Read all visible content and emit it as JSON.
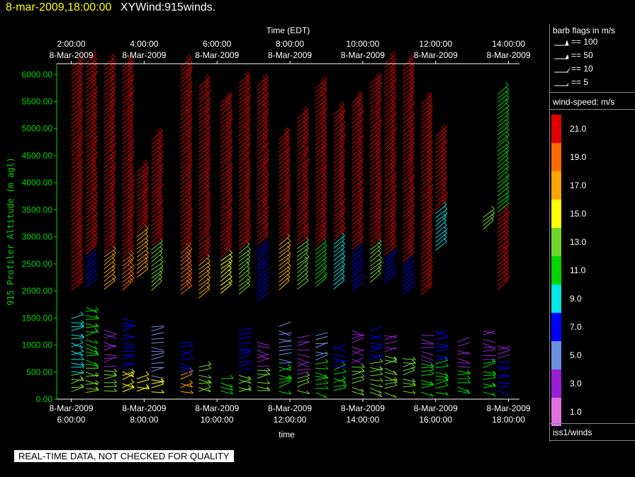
{
  "header": {
    "datetime": "8-mar-2009,18:00:00",
    "product": "XYWind:915winds."
  },
  "disclaimer": "REAL-TIME DATA, NOT CHECKED FOR QUALITY",
  "legend": {
    "barb_title": "barb flags in m/s",
    "barb_flags": [
      "== 100",
      "== 50",
      "== 10",
      "== 5"
    ],
    "speed_title": "wind-speed: m/s",
    "colorbar": [
      {
        "label": "21.0",
        "color": "#e00000"
      },
      {
        "label": "19.0",
        "color": "#ff6a00"
      },
      {
        "label": "17.0",
        "color": "#ffa500"
      },
      {
        "label": "15.0",
        "color": "#ffff00"
      },
      {
        "label": "13.0",
        "color": "#6fd62b"
      },
      {
        "label": "11.0",
        "color": "#00d600"
      },
      {
        "label": "9.0",
        "color": "#00e5e5"
      },
      {
        "label": "7.0",
        "color": "#0000ff"
      },
      {
        "label": "5.0",
        "color": "#6b8fe0"
      },
      {
        "label": "3.0",
        "color": "#9a1ed6"
      },
      {
        "label": "1.0",
        "color": "#e070e0"
      }
    ],
    "dataset": "iss1/winds"
  },
  "chart_data": {
    "type": "scatter",
    "ylabel": "915 Profiler Altitude (m agl)",
    "xlabel_bottom": "time",
    "xlabel_top": "Time (EDT)",
    "ylim": [
      0,
      6200
    ],
    "xlim": [
      5.6,
      18.3
    ],
    "yticks": [
      "0.00",
      "500.00",
      "1000.00",
      "1500.00",
      "2000.00",
      "2500.00",
      "3000.00",
      "3500.00",
      "4000.00",
      "4500.00",
      "5000.00",
      "5500.00",
      "6000.00"
    ],
    "bottom_ticks": [
      {
        "x": 6,
        "date": "8-Mar-2009",
        "time": "6:00:00"
      },
      {
        "x": 8,
        "date": "8-Mar-2009",
        "time": "8:00:00"
      },
      {
        "x": 10,
        "date": "8-Mar-2009",
        "time": "10:00:00"
      },
      {
        "x": 12,
        "date": "8-Mar-2009",
        "time": "12:00:00"
      },
      {
        "x": 14,
        "date": "8-Mar-2009",
        "time": "14:00:00"
      },
      {
        "x": 16,
        "date": "8-Mar-2009",
        "time": "16:00:00"
      },
      {
        "x": 18,
        "date": "8-Mar-2009",
        "time": "18:00:00"
      }
    ],
    "top_ticks": [
      {
        "x": 6,
        "date": "8-Mar-2009",
        "time": "2:00:00"
      },
      {
        "x": 8,
        "date": "8-Mar-2009",
        "time": "4:00:00"
      },
      {
        "x": 10,
        "date": "8-Mar-2009",
        "time": "6:00:00"
      },
      {
        "x": 12,
        "date": "8-Mar-2009",
        "time": "8:00:00"
      },
      {
        "x": 14,
        "date": "8-Mar-2009",
        "time": "10:00:00"
      },
      {
        "x": 16,
        "date": "8-Mar-2009",
        "time": "12:00:00"
      },
      {
        "x": 18,
        "date": "8-Mar-2009",
        "time": "14:00:00"
      }
    ],
    "profiles": [
      {
        "x": 6.0,
        "top": 6200,
        "upper": [
          {
            "from": 2000,
            "speed": 21
          }
        ],
        "low": [
          {
            "to": 500,
            "speed": 13
          },
          {
            "to": 1500,
            "speed": 9
          }
        ]
      },
      {
        "x": 6.4,
        "top": 6200,
        "upper": [
          {
            "from": 2600,
            "speed": 21
          },
          {
            "from": 2000,
            "speed": 7
          }
        ],
        "low": [
          {
            "to": 600,
            "speed": 13
          },
          {
            "to": 1700,
            "speed": 11
          }
        ]
      },
      {
        "x": 6.9,
        "top": 6200,
        "upper": [
          {
            "from": 2700,
            "speed": 21
          },
          {
            "from": 2000,
            "speed": 17
          }
        ],
        "low": [
          {
            "to": 550,
            "speed": 13
          },
          {
            "to": 1300,
            "speed": 3
          }
        ]
      },
      {
        "x": 7.4,
        "top": 6200,
        "upper": [
          {
            "from": 2600,
            "speed": 21
          },
          {
            "from": 2000,
            "speed": 19
          }
        ],
        "low": [
          {
            "to": 550,
            "speed": 15
          },
          {
            "to": 1500,
            "speed": 7
          }
        ]
      },
      {
        "x": 7.8,
        "top": 4200,
        "upper": [
          {
            "from": 3000,
            "speed": 21
          },
          {
            "from": 2200,
            "speed": 17
          }
        ],
        "low": [
          {
            "to": 400,
            "speed": 15
          }
        ]
      },
      {
        "x": 8.2,
        "top": 4800,
        "upper": [
          {
            "from": 2800,
            "speed": 21
          },
          {
            "from": 2000,
            "speed": 13
          }
        ],
        "low": [
          {
            "to": 400,
            "speed": 15
          },
          {
            "to": 1400,
            "speed": 5
          }
        ]
      },
      {
        "x": 9.0,
        "top": 6200,
        "upper": [
          {
            "from": 2700,
            "speed": 21
          },
          {
            "from": 1900,
            "speed": 19
          }
        ],
        "low": [
          {
            "to": 500,
            "speed": 17
          },
          {
            "to": 1100,
            "speed": 7
          }
        ]
      },
      {
        "x": 9.5,
        "top": 5800,
        "upper": [
          {
            "from": 2500,
            "speed": 21
          },
          {
            "from": 1800,
            "speed": 17
          }
        ],
        "low": [
          {
            "to": 600,
            "speed": 13
          }
        ]
      },
      {
        "x": 10.1,
        "top": 5500,
        "upper": [
          {
            "from": 2600,
            "speed": 21
          },
          {
            "from": 1900,
            "speed": 15
          }
        ],
        "low": [
          {
            "to": 450,
            "speed": 11
          }
        ]
      },
      {
        "x": 10.6,
        "top": 5900,
        "upper": [
          {
            "from": 2700,
            "speed": 21
          },
          {
            "from": 1900,
            "speed": 13
          }
        ],
        "low": [
          {
            "to": 450,
            "speed": 13
          },
          {
            "to": 1300,
            "speed": 7
          }
        ]
      },
      {
        "x": 11.1,
        "top": 5800,
        "upper": [
          {
            "from": 2800,
            "speed": 21
          },
          {
            "from": 1800,
            "speed": 7
          }
        ],
        "low": [
          {
            "to": 600,
            "speed": 13
          },
          {
            "to": 1100,
            "speed": 3
          }
        ]
      },
      {
        "x": 11.7,
        "top": 4800,
        "upper": [
          {
            "from": 2900,
            "speed": 21
          },
          {
            "from": 2000,
            "speed": 17
          }
        ],
        "low": [
          {
            "to": 600,
            "speed": 11
          },
          {
            "to": 1400,
            "speed": 5
          }
        ]
      },
      {
        "x": 12.2,
        "top": 5200,
        "upper": [
          {
            "from": 2800,
            "speed": 21
          },
          {
            "from": 2000,
            "speed": 13
          }
        ],
        "low": [
          {
            "to": 450,
            "speed": 13
          },
          {
            "to": 1200,
            "speed": 3
          }
        ]
      },
      {
        "x": 12.7,
        "top": 5800,
        "upper": [
          {
            "from": 2800,
            "speed": 21
          },
          {
            "from": 2000,
            "speed": 11
          }
        ],
        "low": [
          {
            "to": 700,
            "speed": 11
          },
          {
            "to": 1200,
            "speed": 5
          }
        ]
      },
      {
        "x": 13.2,
        "top": 5300,
        "upper": [
          {
            "from": 2900,
            "speed": 21
          },
          {
            "from": 2000,
            "speed": 9
          }
        ],
        "low": [
          {
            "to": 600,
            "speed": 11
          },
          {
            "to": 1000,
            "speed": 7
          }
        ]
      },
      {
        "x": 13.7,
        "top": 5500,
        "upper": [
          {
            "from": 2700,
            "speed": 21
          },
          {
            "from": 2000,
            "speed": 7
          }
        ],
        "low": [
          {
            "to": 600,
            "speed": 13
          },
          {
            "to": 1300,
            "speed": 3
          }
        ]
      },
      {
        "x": 14.2,
        "top": 5900,
        "upper": [
          {
            "from": 2800,
            "speed": 21
          },
          {
            "from": 2100,
            "speed": 13
          }
        ],
        "low": [
          {
            "to": 700,
            "speed": 13
          },
          {
            "to": 1300,
            "speed": 7
          }
        ]
      },
      {
        "x": 14.6,
        "top": 6200,
        "upper": [
          {
            "from": 2600,
            "speed": 21
          },
          {
            "from": 2100,
            "speed": 7
          }
        ],
        "low": [
          {
            "to": 800,
            "speed": 13
          },
          {
            "to": 1200,
            "speed": 3
          }
        ]
      },
      {
        "x": 15.1,
        "top": 6200,
        "upper": [
          {
            "from": 2500,
            "speed": 21
          },
          {
            "from": 1900,
            "speed": 7
          }
        ],
        "low": [
          {
            "to": 800,
            "speed": 13
          }
        ]
      },
      {
        "x": 15.6,
        "top": 5500,
        "upper": [
          {
            "from": 1900,
            "speed": 21
          }
        ],
        "low": [
          {
            "to": 700,
            "speed": 11
          },
          {
            "to": 1200,
            "speed": 3
          }
        ]
      },
      {
        "x": 16.0,
        "top": 4900,
        "upper": [
          {
            "from": 3500,
            "speed": 21
          },
          {
            "from": 2700,
            "speed": 9
          }
        ],
        "low": [
          {
            "to": 700,
            "speed": 11
          },
          {
            "to": 1300,
            "speed": 7
          }
        ]
      },
      {
        "x": 16.6,
        "top": 1100,
        "upper": [],
        "low": [
          {
            "to": 600,
            "speed": 11
          },
          {
            "to": 1100,
            "speed": 3
          }
        ]
      },
      {
        "x": 17.3,
        "top": 3400,
        "upper": [
          {
            "from": 3100,
            "speed": 13
          }
        ],
        "low": [
          {
            "to": 700,
            "speed": 11
          },
          {
            "to": 1300,
            "speed": 3
          }
        ]
      },
      {
        "x": 17.7,
        "top": 5700,
        "upper": [
          {
            "from": 3400,
            "speed": 11
          },
          {
            "from": 2000,
            "speed": 21
          }
        ],
        "low": [
          {
            "to": 700,
            "speed": 7
          },
          {
            "to": 1000,
            "speed": 3
          }
        ]
      }
    ]
  }
}
